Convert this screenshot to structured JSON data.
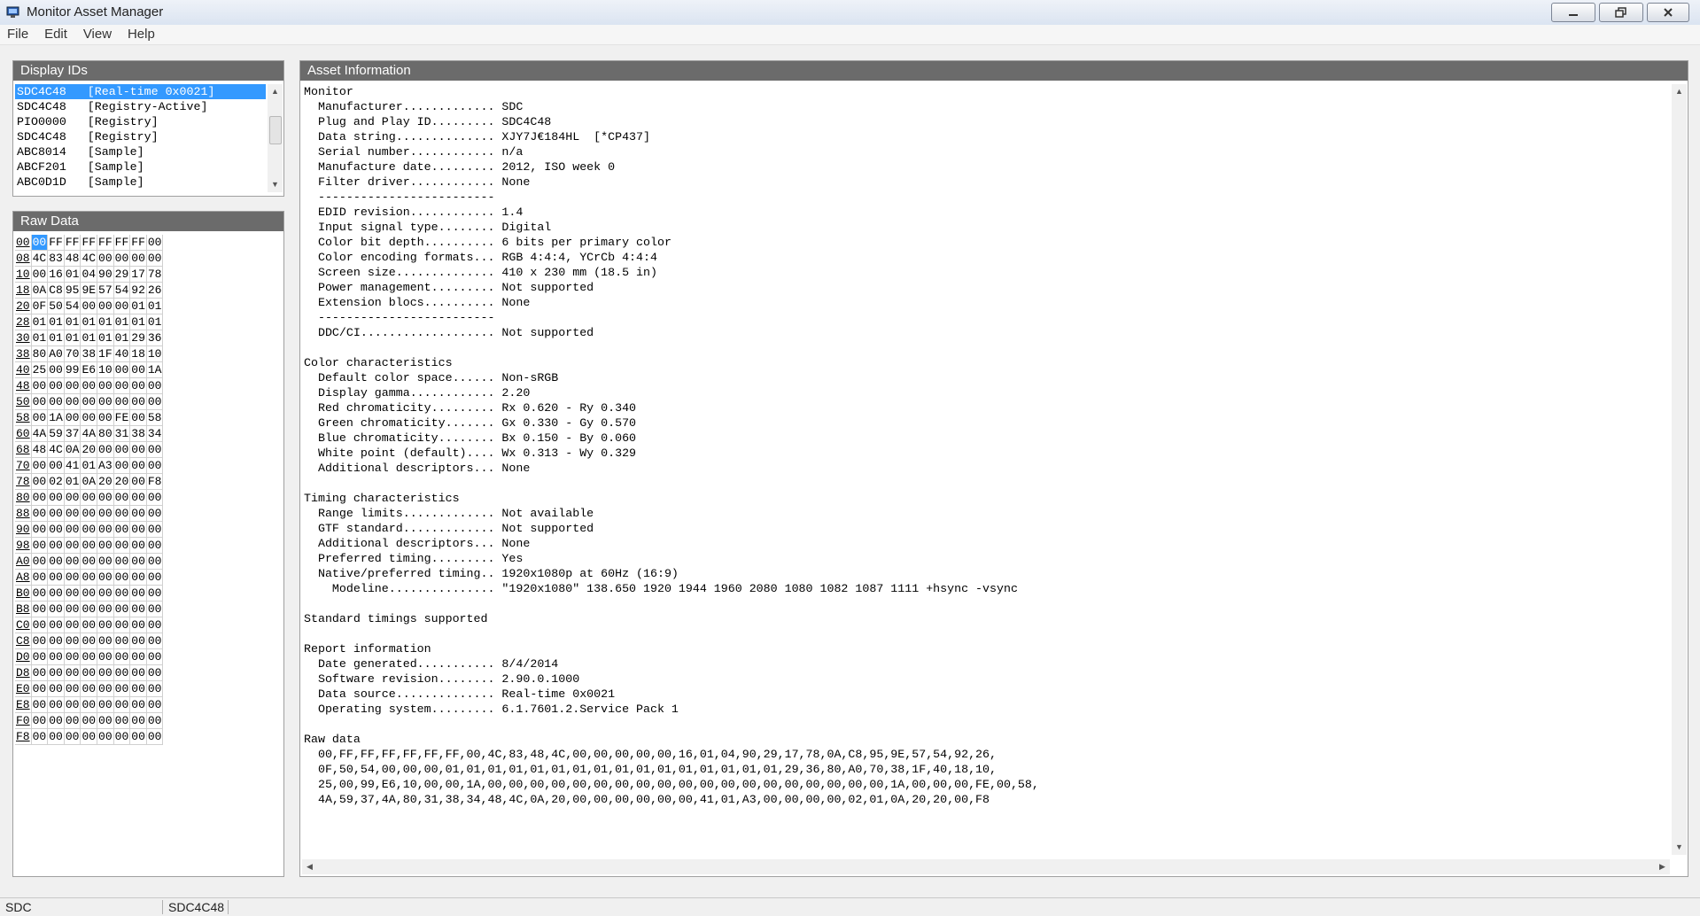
{
  "window": {
    "title": "Monitor Asset Manager"
  },
  "menu": [
    "File",
    "Edit",
    "View",
    "Help"
  ],
  "display_ids": {
    "header": "Display IDs",
    "items": [
      "SDC4C48   [Real-time 0x0021]",
      "SDC4C48   [Registry-Active]",
      "PIO0000   [Registry]",
      "SDC4C48   [Registry]",
      "ABC8014   [Sample]",
      "ABCF201   [Sample]",
      "ABC0D1D   [Sample]"
    ]
  },
  "raw_data": {
    "header": "Raw Data",
    "rows": [
      {
        "addr": "00",
        "bytes": [
          "00",
          "FF",
          "FF",
          "FF",
          "FF",
          "FF",
          "FF",
          "00"
        ]
      },
      {
        "addr": "08",
        "bytes": [
          "4C",
          "83",
          "48",
          "4C",
          "00",
          "00",
          "00",
          "00"
        ]
      },
      {
        "addr": "10",
        "bytes": [
          "00",
          "16",
          "01",
          "04",
          "90",
          "29",
          "17",
          "78"
        ]
      },
      {
        "addr": "18",
        "bytes": [
          "0A",
          "C8",
          "95",
          "9E",
          "57",
          "54",
          "92",
          "26"
        ]
      },
      {
        "addr": "20",
        "bytes": [
          "0F",
          "50",
          "54",
          "00",
          "00",
          "00",
          "01",
          "01"
        ]
      },
      {
        "addr": "28",
        "bytes": [
          "01",
          "01",
          "01",
          "01",
          "01",
          "01",
          "01",
          "01"
        ]
      },
      {
        "addr": "30",
        "bytes": [
          "01",
          "01",
          "01",
          "01",
          "01",
          "01",
          "29",
          "36"
        ]
      },
      {
        "addr": "38",
        "bytes": [
          "80",
          "A0",
          "70",
          "38",
          "1F",
          "40",
          "18",
          "10"
        ]
      },
      {
        "addr": "40",
        "bytes": [
          "25",
          "00",
          "99",
          "E6",
          "10",
          "00",
          "00",
          "1A"
        ]
      },
      {
        "addr": "48",
        "bytes": [
          "00",
          "00",
          "00",
          "00",
          "00",
          "00",
          "00",
          "00"
        ]
      },
      {
        "addr": "50",
        "bytes": [
          "00",
          "00",
          "00",
          "00",
          "00",
          "00",
          "00",
          "00"
        ]
      },
      {
        "addr": "58",
        "bytes": [
          "00",
          "1A",
          "00",
          "00",
          "00",
          "FE",
          "00",
          "58"
        ]
      },
      {
        "addr": "60",
        "bytes": [
          "4A",
          "59",
          "37",
          "4A",
          "80",
          "31",
          "38",
          "34"
        ]
      },
      {
        "addr": "68",
        "bytes": [
          "48",
          "4C",
          "0A",
          "20",
          "00",
          "00",
          "00",
          "00"
        ]
      },
      {
        "addr": "70",
        "bytes": [
          "00",
          "00",
          "41",
          "01",
          "A3",
          "00",
          "00",
          "00"
        ]
      },
      {
        "addr": "78",
        "bytes": [
          "00",
          "02",
          "01",
          "0A",
          "20",
          "20",
          "00",
          "F8"
        ]
      },
      {
        "addr": "80",
        "bytes": [
          "00",
          "00",
          "00",
          "00",
          "00",
          "00",
          "00",
          "00"
        ]
      },
      {
        "addr": "88",
        "bytes": [
          "00",
          "00",
          "00",
          "00",
          "00",
          "00",
          "00",
          "00"
        ]
      },
      {
        "addr": "90",
        "bytes": [
          "00",
          "00",
          "00",
          "00",
          "00",
          "00",
          "00",
          "00"
        ]
      },
      {
        "addr": "98",
        "bytes": [
          "00",
          "00",
          "00",
          "00",
          "00",
          "00",
          "00",
          "00"
        ]
      },
      {
        "addr": "A0",
        "bytes": [
          "00",
          "00",
          "00",
          "00",
          "00",
          "00",
          "00",
          "00"
        ]
      },
      {
        "addr": "A8",
        "bytes": [
          "00",
          "00",
          "00",
          "00",
          "00",
          "00",
          "00",
          "00"
        ]
      },
      {
        "addr": "B0",
        "bytes": [
          "00",
          "00",
          "00",
          "00",
          "00",
          "00",
          "00",
          "00"
        ]
      },
      {
        "addr": "B8",
        "bytes": [
          "00",
          "00",
          "00",
          "00",
          "00",
          "00",
          "00",
          "00"
        ]
      },
      {
        "addr": "C0",
        "bytes": [
          "00",
          "00",
          "00",
          "00",
          "00",
          "00",
          "00",
          "00"
        ]
      },
      {
        "addr": "C8",
        "bytes": [
          "00",
          "00",
          "00",
          "00",
          "00",
          "00",
          "00",
          "00"
        ]
      },
      {
        "addr": "D0",
        "bytes": [
          "00",
          "00",
          "00",
          "00",
          "00",
          "00",
          "00",
          "00"
        ]
      },
      {
        "addr": "D8",
        "bytes": [
          "00",
          "00",
          "00",
          "00",
          "00",
          "00",
          "00",
          "00"
        ]
      },
      {
        "addr": "E0",
        "bytes": [
          "00",
          "00",
          "00",
          "00",
          "00",
          "00",
          "00",
          "00"
        ]
      },
      {
        "addr": "E8",
        "bytes": [
          "00",
          "00",
          "00",
          "00",
          "00",
          "00",
          "00",
          "00"
        ]
      },
      {
        "addr": "F0",
        "bytes": [
          "00",
          "00",
          "00",
          "00",
          "00",
          "00",
          "00",
          "00"
        ]
      },
      {
        "addr": "F8",
        "bytes": [
          "00",
          "00",
          "00",
          "00",
          "00",
          "00",
          "00",
          "00"
        ]
      }
    ]
  },
  "asset_info": {
    "header": "Asset Information",
    "lines": [
      "Monitor",
      "  Manufacturer............. SDC",
      "  Plug and Play ID......... SDC4C48",
      "  Data string.............. XJY7J€184HL  [*CP437]",
      "  Serial number............ n/a",
      "  Manufacture date......... 2012, ISO week 0",
      "  Filter driver............ None",
      "  -------------------------",
      "  EDID revision............ 1.4",
      "  Input signal type........ Digital",
      "  Color bit depth.......... 6 bits per primary color",
      "  Color encoding formats... RGB 4:4:4, YCrCb 4:4:4",
      "  Screen size.............. 410 x 230 mm (18.5 in)",
      "  Power management......... Not supported",
      "  Extension blocs.......... None",
      "  -------------------------",
      "  DDC/CI................... Not supported",
      "",
      "Color characteristics",
      "  Default color space...... Non-sRGB",
      "  Display gamma............ 2.20",
      "  Red chromaticity......... Rx 0.620 - Ry 0.340",
      "  Green chromaticity....... Gx 0.330 - Gy 0.570",
      "  Blue chromaticity........ Bx 0.150 - By 0.060",
      "  White point (default).... Wx 0.313 - Wy 0.329",
      "  Additional descriptors... None",
      "",
      "Timing characteristics",
      "  Range limits............. Not available",
      "  GTF standard............. Not supported",
      "  Additional descriptors... None",
      "  Preferred timing......... Yes",
      "  Native/preferred timing.. 1920x1080p at 60Hz (16:9)",
      "    Modeline............... \"1920x1080\" 138.650 1920 1944 1960 2080 1080 1082 1087 1111 +hsync -vsync",
      "",
      "Standard timings supported",
      "",
      "Report information",
      "  Date generated........... 8/4/2014",
      "  Software revision........ 2.90.0.1000",
      "  Data source.............. Real-time 0x0021",
      "  Operating system......... 6.1.7601.2.Service Pack 1",
      "",
      "Raw data",
      "  00,FF,FF,FF,FF,FF,FF,00,4C,83,48,4C,00,00,00,00,00,16,01,04,90,29,17,78,0A,C8,95,9E,57,54,92,26,",
      "  0F,50,54,00,00,00,01,01,01,01,01,01,01,01,01,01,01,01,01,01,01,01,29,36,80,A0,70,38,1F,40,18,10,",
      "  25,00,99,E6,10,00,00,1A,00,00,00,00,00,00,00,00,00,00,00,00,00,00,00,00,00,00,00,1A,00,00,00,FE,00,58,",
      "  4A,59,37,4A,80,31,38,34,48,4C,0A,20,00,00,00,00,00,00,41,01,A3,00,00,00,00,02,01,0A,20,20,00,F8"
    ]
  },
  "status": {
    "manufacturer": "SDC",
    "pnp_id": "SDC4C48"
  },
  "colors": {
    "selection": "#3399ff",
    "panel_header": "#6b6b6b"
  }
}
